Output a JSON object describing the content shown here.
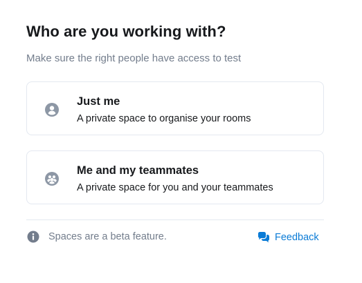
{
  "dialog": {
    "title": "Who are you working with?",
    "subtitle": "Make sure the right people have access to test"
  },
  "options": [
    {
      "title": "Just me",
      "description": "A private space to organise your rooms",
      "icon": "user-icon"
    },
    {
      "title": "Me and my teammates",
      "description": "A private space for you and your teammates",
      "icon": "group-icon"
    }
  ],
  "footer": {
    "info_text": "Spaces are a beta feature.",
    "info_icon": "info-icon",
    "feedback_label": "Feedback",
    "feedback_icon": "chat-bubbles-icon"
  },
  "colors": {
    "text_primary": "#17191c",
    "text_secondary": "#737d8c",
    "icon_gray": "#8d97a5",
    "border": "#e3e8f0",
    "link_blue": "#0a7bd6"
  }
}
